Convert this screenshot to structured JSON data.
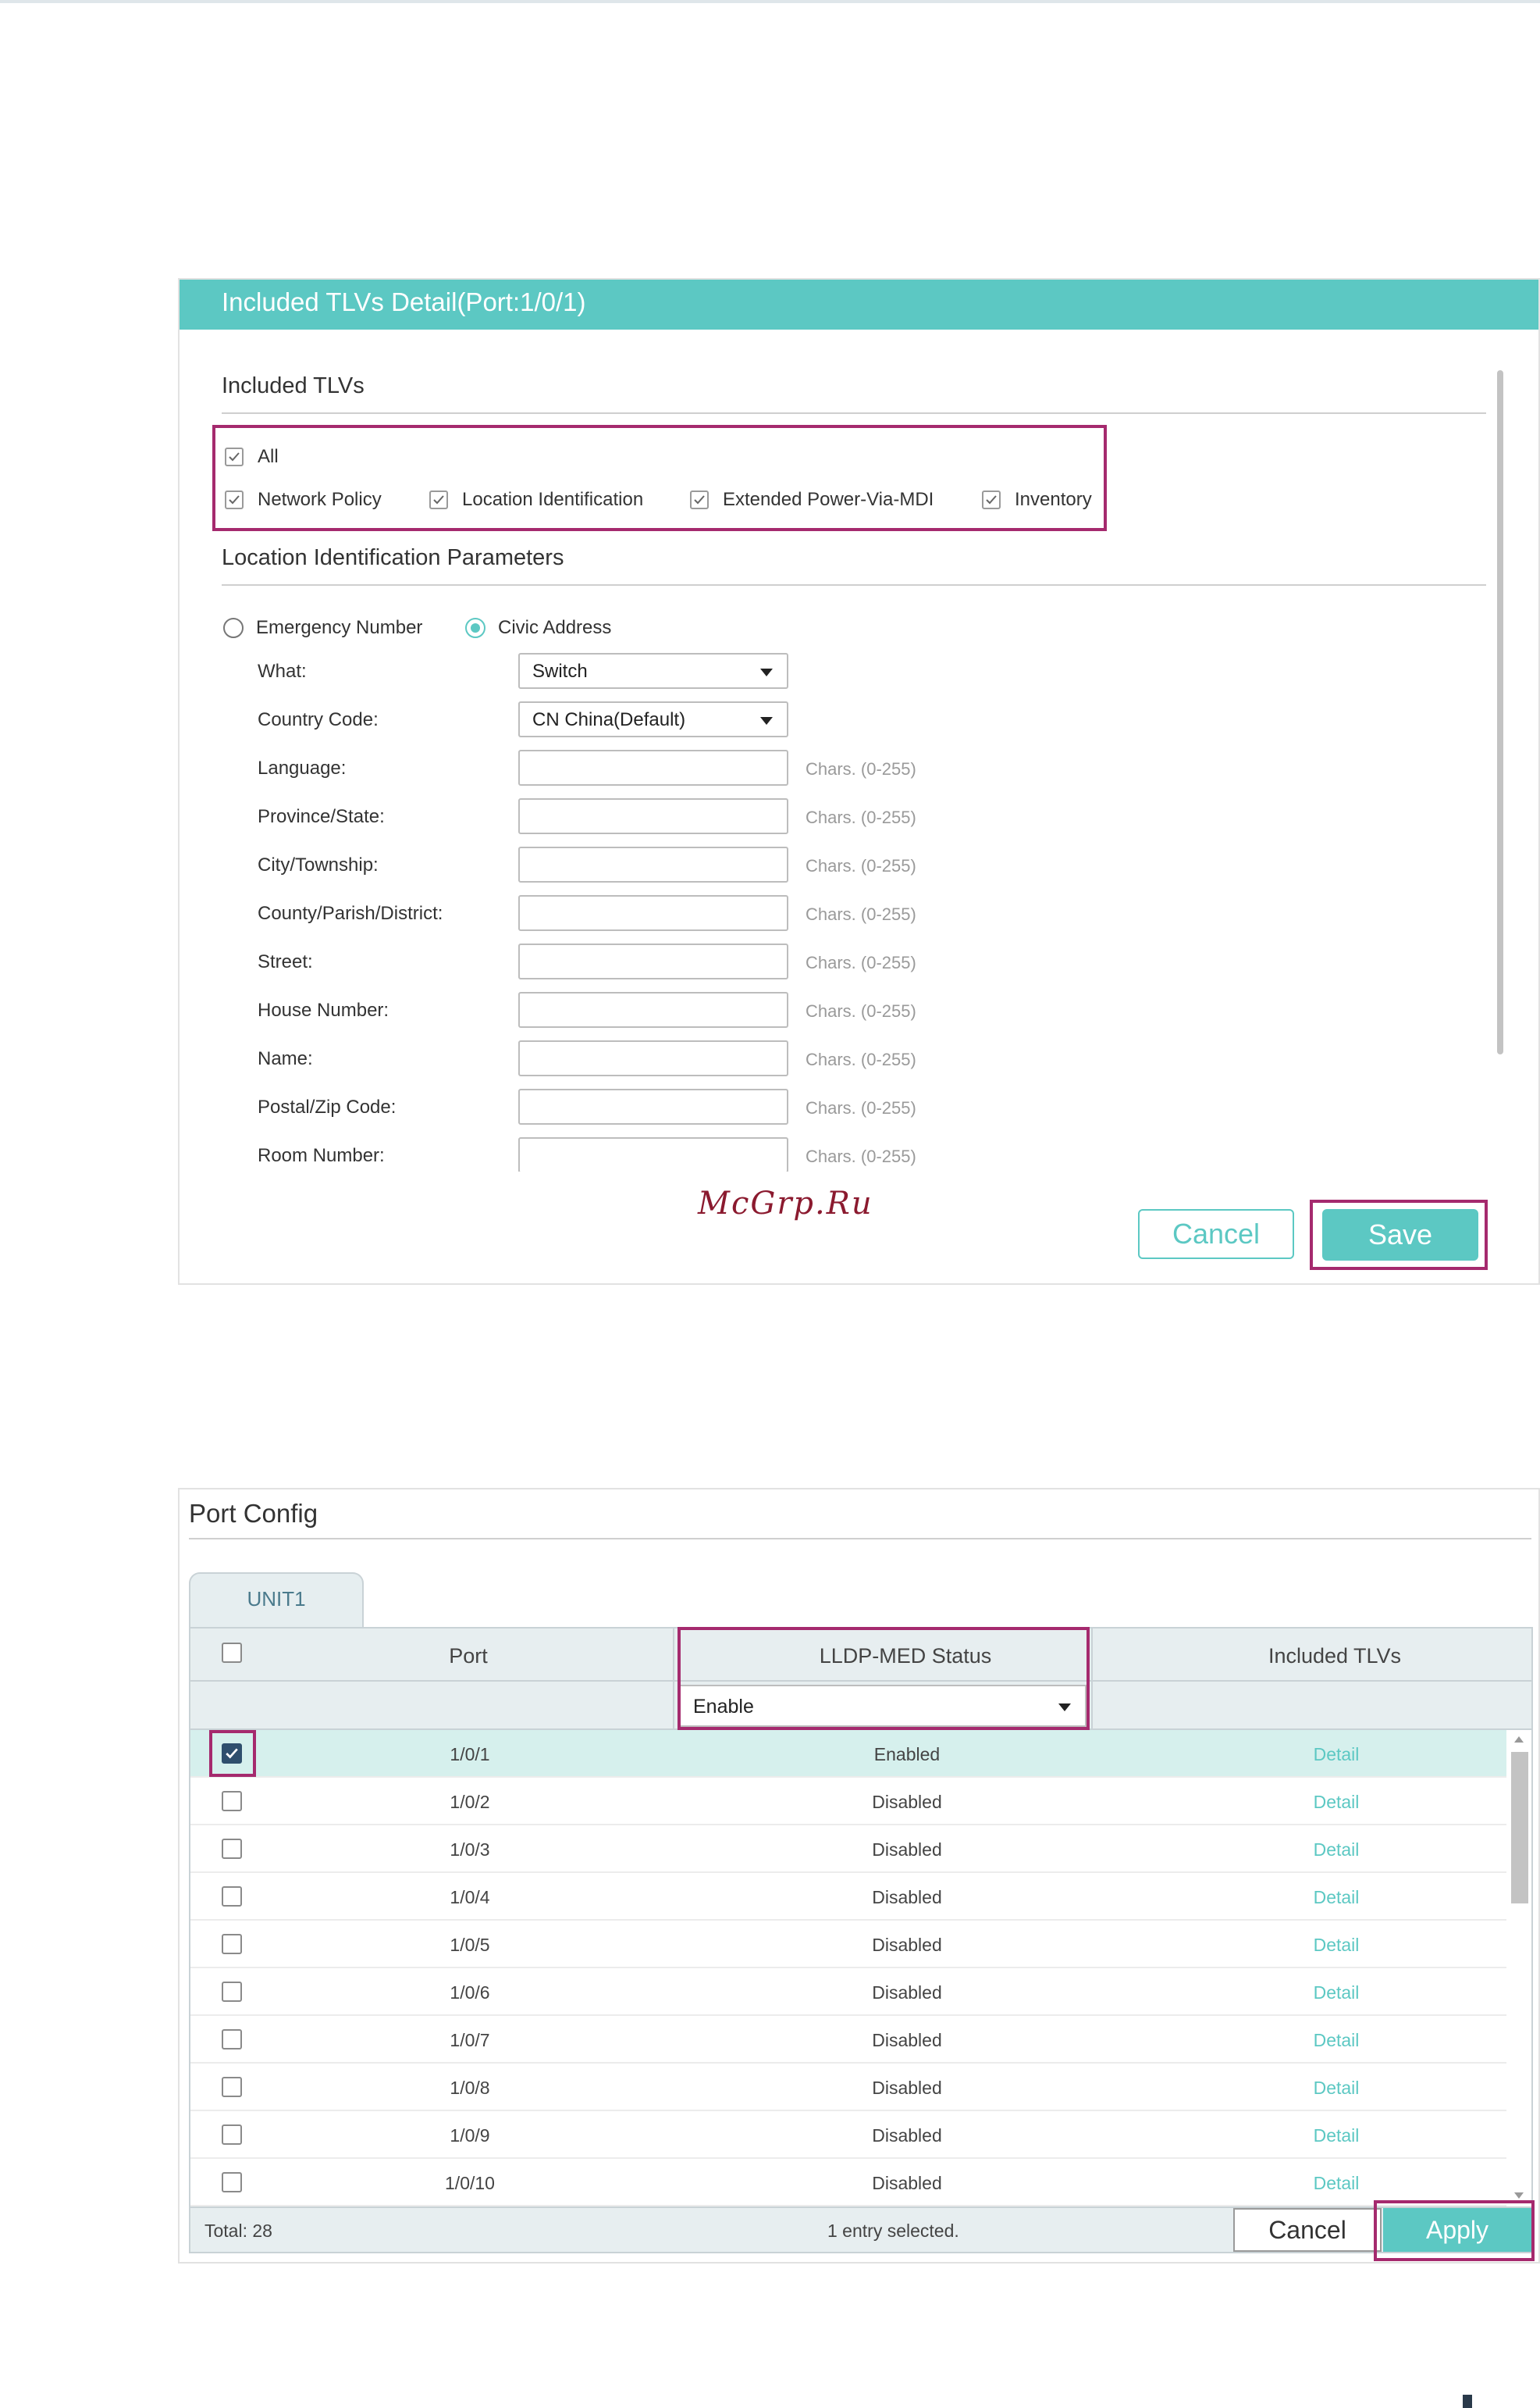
{
  "detail_panel": {
    "title": "Included TLVs Detail(Port:1/0/1)",
    "included_tlvs": {
      "heading": "Included TLVs",
      "all_label": "All",
      "items": [
        {
          "label": "Network Policy",
          "checked": true
        },
        {
          "label": "Location Identification",
          "checked": true
        },
        {
          "label": "Extended Power-Via-MDI",
          "checked": true
        },
        {
          "label": "Inventory",
          "checked": true
        }
      ]
    },
    "location_params": {
      "heading": "Location Identification Parameters",
      "radio_emergency": "Emergency Number",
      "radio_civic": "Civic Address",
      "selected": "Civic Address",
      "what_label": "What:",
      "what_value": "Switch",
      "country_label": "Country Code:",
      "country_value": "CN China(Default)",
      "hint": "Chars. (0-255)",
      "fields": [
        {
          "label": "Language:",
          "value": ""
        },
        {
          "label": "Province/State:",
          "value": ""
        },
        {
          "label": "City/Township:",
          "value": ""
        },
        {
          "label": "County/Parish/District:",
          "value": ""
        },
        {
          "label": "Street:",
          "value": ""
        },
        {
          "label": "House Number:",
          "value": ""
        },
        {
          "label": "Name:",
          "value": ""
        },
        {
          "label": "Postal/Zip Code:",
          "value": ""
        },
        {
          "label": "Room Number:",
          "value": ""
        }
      ]
    },
    "watermark": "McGrp.Ru",
    "cancel_label": "Cancel",
    "save_label": "Save"
  },
  "port_config": {
    "title": "Port Config",
    "tab_label": "UNIT1",
    "columns": {
      "port": "Port",
      "status": "LLDP-MED Status",
      "tlvs": "Included TLVs"
    },
    "status_filter": "Enable",
    "rows": [
      {
        "port": "1/0/1",
        "status": "Enabled",
        "tlvs": "Detail"
      },
      {
        "port": "1/0/2",
        "status": "Disabled",
        "tlvs": "Detail"
      },
      {
        "port": "1/0/3",
        "status": "Disabled",
        "tlvs": "Detail"
      },
      {
        "port": "1/0/4",
        "status": "Disabled",
        "tlvs": "Detail"
      },
      {
        "port": "1/0/5",
        "status": "Disabled",
        "tlvs": "Detail"
      },
      {
        "port": "1/0/6",
        "status": "Disabled",
        "tlvs": "Detail"
      },
      {
        "port": "1/0/7",
        "status": "Disabled",
        "tlvs": "Detail"
      },
      {
        "port": "1/0/8",
        "status": "Disabled",
        "tlvs": "Detail"
      },
      {
        "port": "1/0/9",
        "status": "Disabled",
        "tlvs": "Detail"
      },
      {
        "port": "1/0/10",
        "status": "Disabled",
        "tlvs": "Detail"
      }
    ],
    "total_text": "Total: 28",
    "selected_text": "1 entry selected.",
    "cancel_label": "Cancel",
    "apply_label": "Apply"
  },
  "colors": {
    "accent": "#5cc8c3",
    "highlight": "#a52a6e",
    "selected_row": "#d6f0ed"
  }
}
